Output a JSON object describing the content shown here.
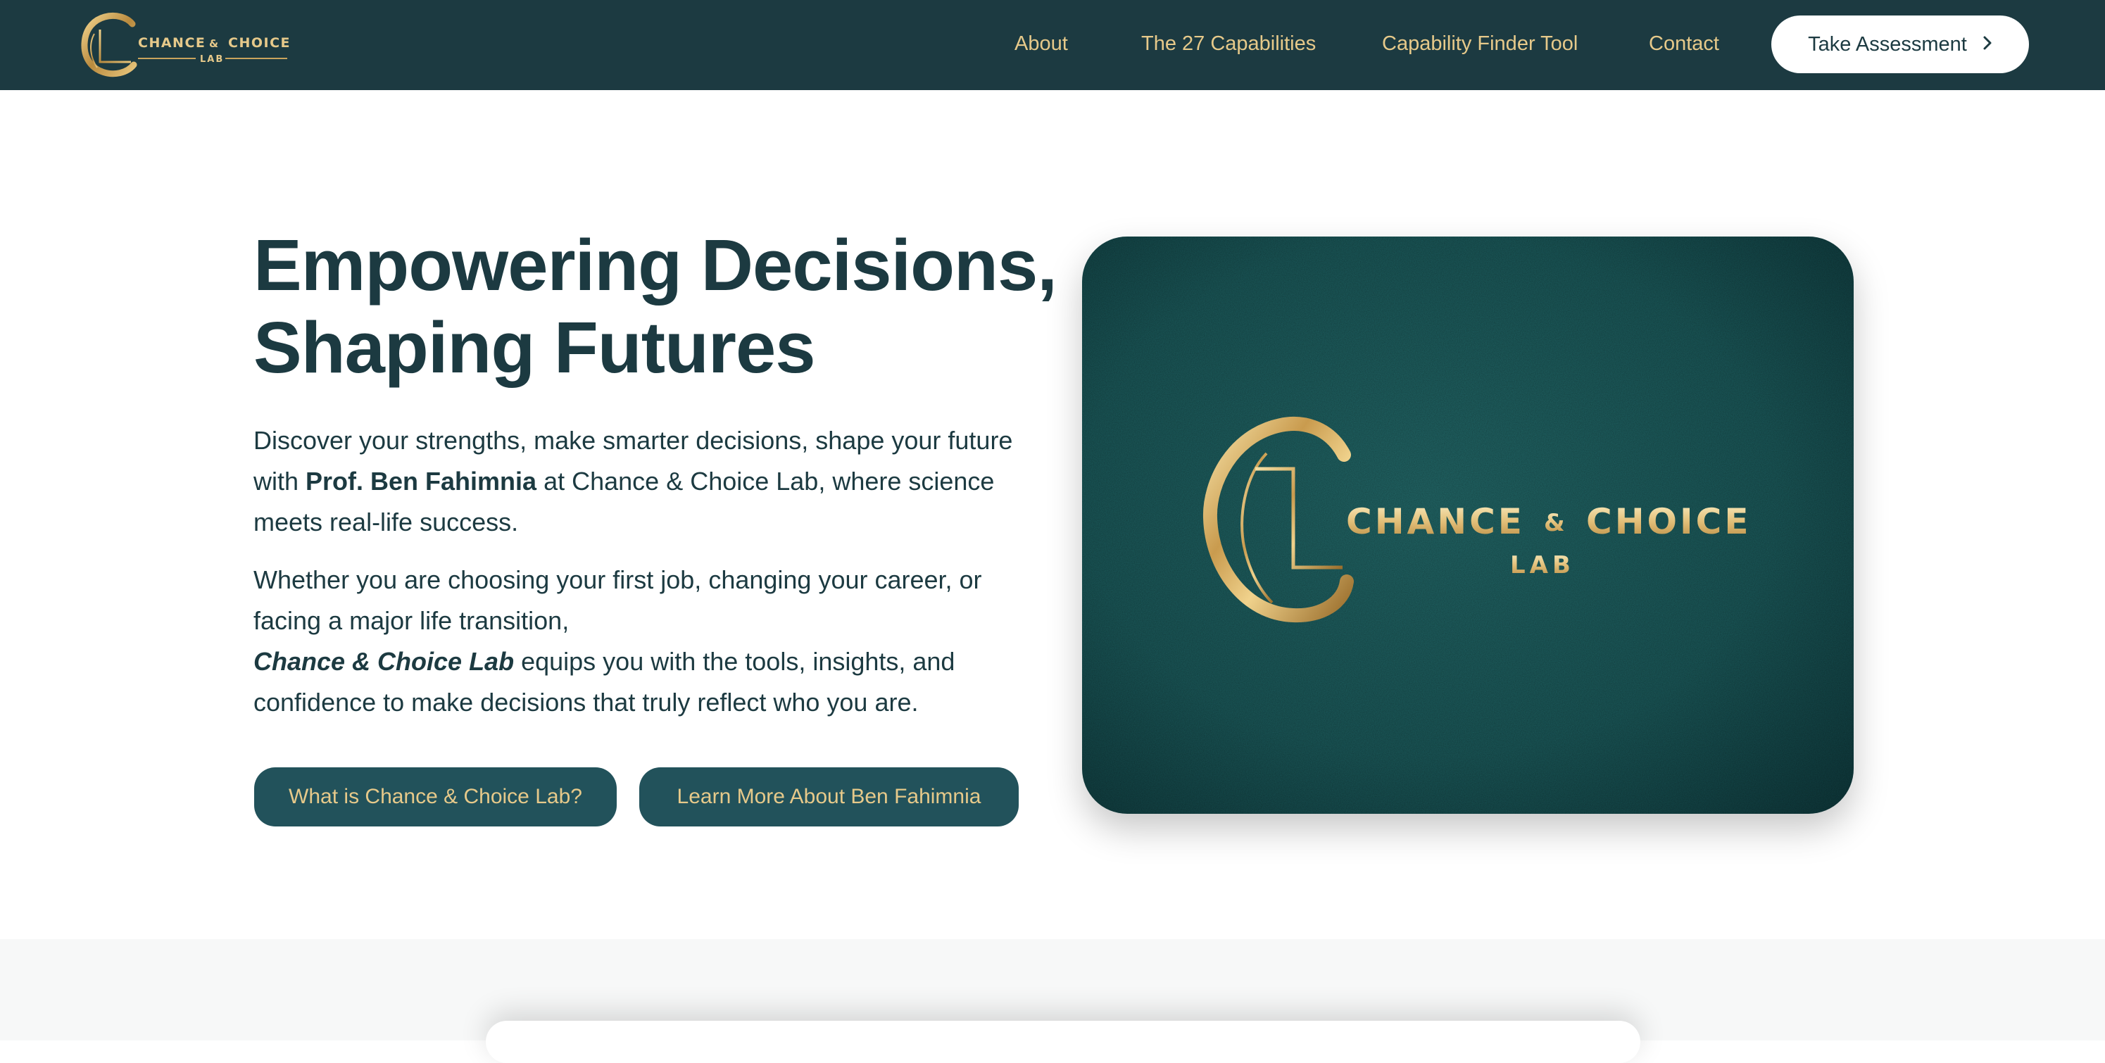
{
  "brand": {
    "name_left": "CHANCE",
    "ampersand": "&",
    "name_right": "CHOICE",
    "sub": "LAB",
    "colors": {
      "gold": "#c9a45c",
      "teal_dark": "#1c3a41"
    }
  },
  "nav": {
    "about": "About",
    "capabilities": "The 27 Capabilities",
    "finder": "Capability Finder Tool",
    "contact": "Contact",
    "cta": "Take Assessment",
    "cta_icon": "chevron-right-icon"
  },
  "hero": {
    "title_line1": "Empowering Decisions,",
    "title_line2": "Shaping Futures",
    "p1_before": "Discover your strengths, make smarter decisions, shape your future with ",
    "p1_name": "Prof. Ben Fahimnia",
    "p1_after": " at Chance & Choice Lab, where science meets real-life success.",
    "p2_line": "Whether you are choosing your first job, changing your career, or facing a major life transition,",
    "p2_brand": "Chance & Choice Lab",
    "p2_after": " equips you with the tools, insights, and confidence to make decisions that truly reflect who you are.",
    "button1": "What is Chance & Choice Lab?",
    "button2": "Learn More About Ben Fahimnia",
    "image": {
      "logo_left": "CHANCE",
      "logo_amp": "&",
      "logo_right": "CHOICE",
      "logo_sub": "LAB",
      "background_color": "#1d5a5b"
    }
  },
  "colors": {
    "primary": "#1c3a41",
    "button_bg": "#22525b",
    "accent_gold": "#e6c98a",
    "section_bg": "#f7f8f8"
  }
}
